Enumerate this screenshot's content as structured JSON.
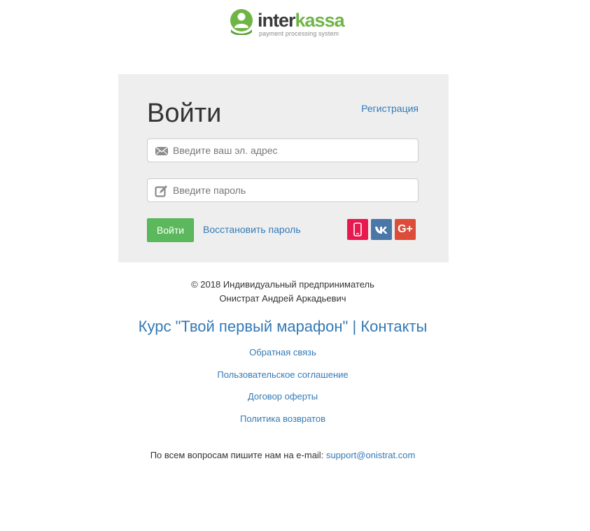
{
  "logo": {
    "name_part1": "inter",
    "name_part2": "kassa",
    "tagline": "payment processing system",
    "icon": "interkassa-logo-icon",
    "brand_color": "#6fb545"
  },
  "login": {
    "title": "Войти",
    "register_label": "Регистрация",
    "email_placeholder": "Введите ваш эл. адрес",
    "email_value": "",
    "email_icon": "envelope-icon",
    "password_placeholder": "Введите пароль",
    "password_value": "",
    "password_icon": "pencil-edit-icon",
    "submit_label": "Войти",
    "restore_label": "Восстановить пароль",
    "social": [
      {
        "name": "phone-login-button",
        "icon": "mobile-phone-icon",
        "color": "#e8194f"
      },
      {
        "name": "vk-login-button",
        "icon": "vk-icon",
        "color": "#4a76a8"
      },
      {
        "name": "google-plus-login-button",
        "icon": "google-plus-icon",
        "label": "G+",
        "color": "#dd4b39"
      }
    ],
    "submit_color": "#5cb85c",
    "panel_color": "#eeeeee"
  },
  "footer": {
    "copyright_line1": "© 2018 Индивидуальный предприниматель",
    "copyright_line2": "Онистрат Андрей Аркадьевич",
    "course_link": "Курс \"Твой первый марафон\"",
    "separator": "|",
    "contacts_link": "Контакты",
    "links": [
      "Обратная связь",
      "Пользовательское соглашение",
      "Договор оферты",
      "Политика возвратов"
    ],
    "contact_text": "По всем вопросам пишите нам на e-mail:",
    "contact_email": "support@onistrat.com",
    "link_color": "#337ab7"
  }
}
